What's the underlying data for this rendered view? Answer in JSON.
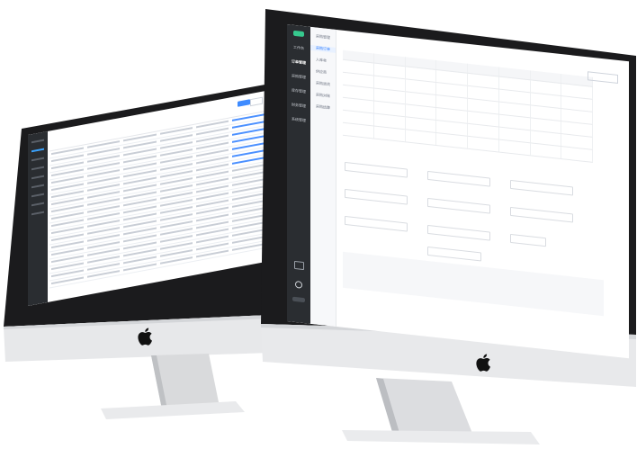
{
  "accent_color": "#2b7bff",
  "dark_sidebar_color": "#2a2d31",
  "monitors": 2,
  "front_sidebar_items": [
    "工作台",
    "订单管理",
    "采购管理",
    "库存管理",
    "财务管理",
    "系统管理"
  ],
  "front_sub_items": [
    "采购管理",
    "采购订单",
    "入库单",
    "供应商",
    "采购退货",
    "采购对账",
    "采购结算"
  ],
  "back_sidebar_count": 9,
  "icons": [
    "apple-logo",
    "settings-icon",
    "power-icon"
  ]
}
